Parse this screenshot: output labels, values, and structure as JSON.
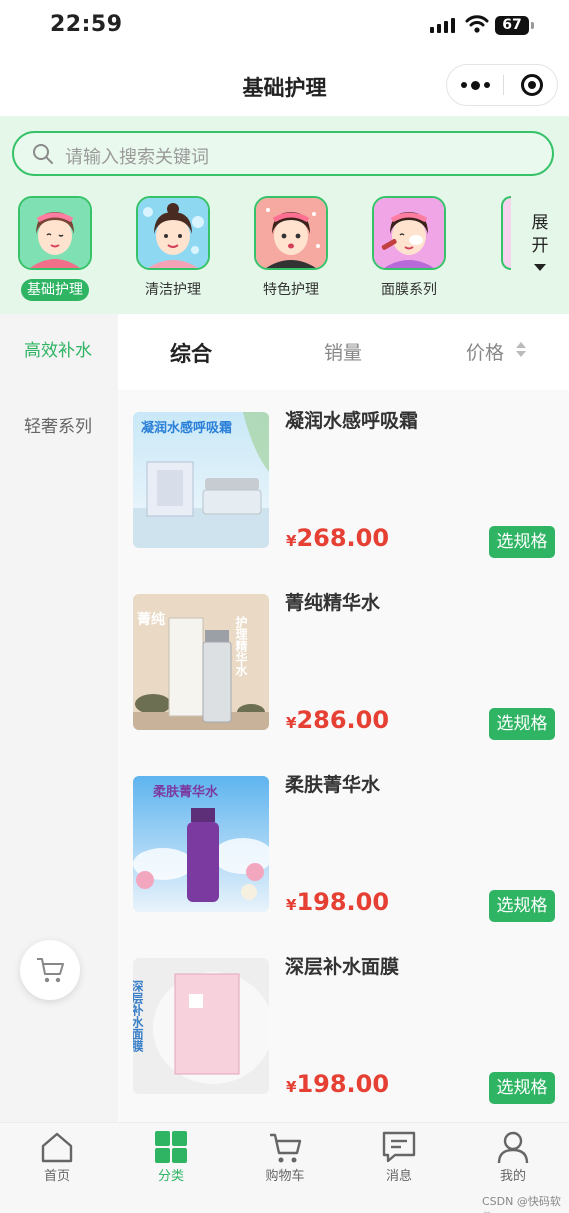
{
  "status": {
    "time": "22:59",
    "battery": "67"
  },
  "nav": {
    "title": "基础护理"
  },
  "search": {
    "placeholder": "请输入搜索关键词"
  },
  "categories": [
    {
      "label": "基础护理",
      "active": true
    },
    {
      "label": "清洁护理",
      "active": false
    },
    {
      "label": "特色护理",
      "active": false
    },
    {
      "label": "面膜系列",
      "active": false
    }
  ],
  "expand": {
    "line1": "展",
    "line2": "开"
  },
  "sidebar": {
    "items": [
      {
        "label": "高效补水",
        "active": true
      },
      {
        "label": "轻奢系列",
        "active": false
      }
    ]
  },
  "sort": {
    "comprehensive": "综合",
    "sales": "销量",
    "price": "价格"
  },
  "products": [
    {
      "name": "凝润水感呼吸霜",
      "currency": "¥",
      "price": "268.00",
      "button": "选规格",
      "image_text": "凝润水感呼吸霜"
    },
    {
      "name": "菁纯精华水",
      "currency": "¥",
      "price": "286.00",
      "button": "选规格",
      "image_text_left": "菁纯",
      "image_text_right": "护理精华水"
    },
    {
      "name": "柔肤菁华水",
      "currency": "¥",
      "price": "198.00",
      "button": "选规格",
      "image_text": "柔肤菁华水"
    },
    {
      "name": "深层补水面膜",
      "currency": "¥",
      "price": "198.00",
      "button": "选规格",
      "image_text": "深层补水面膜"
    }
  ],
  "tabbar": [
    {
      "label": "首页",
      "icon": "home-icon"
    },
    {
      "label": "分类",
      "icon": "category-icon",
      "active": true
    },
    {
      "label": "购物车",
      "icon": "cart-icon"
    },
    {
      "label": "消息",
      "icon": "message-icon"
    },
    {
      "label": "我的",
      "icon": "user-icon"
    }
  ],
  "watermark": "CSDN @快码软件",
  "colors": {
    "accent": "#2fb463",
    "price": "#e63f33",
    "header_bg": "#e4f7e8"
  }
}
